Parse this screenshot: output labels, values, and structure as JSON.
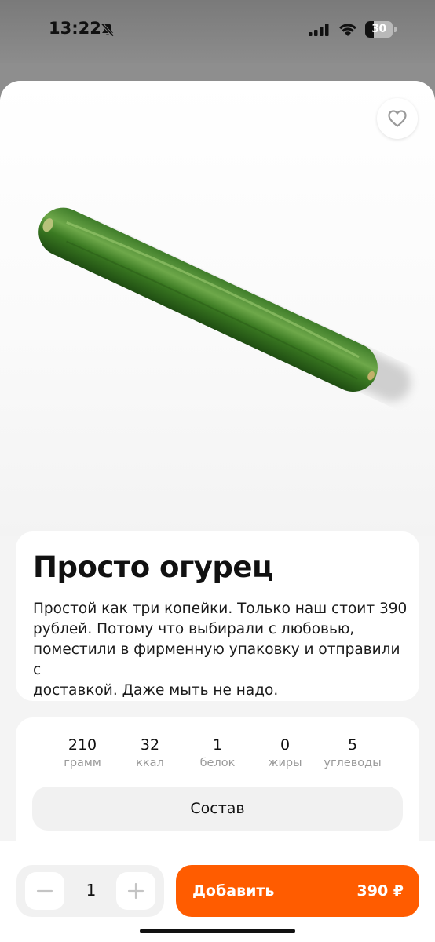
{
  "status_bar": {
    "time": "13:22",
    "battery_level": "30",
    "silent_mode_icon": "bell-slash-icon",
    "signal_icon": "cellular-signal-icon",
    "wifi_icon": "wifi-icon"
  },
  "product": {
    "image_icon": "cucumber-photo",
    "favorite_icon": "heart-icon",
    "title": "Просто огурец",
    "description_lines": [
      "Простой как три копейки. Только наш стоит 390",
      "рублей. Потому что выбирали с любовью,",
      "поместили в фирменную упаковку и отправили с",
      "доставкой. Даже мыть не надо."
    ]
  },
  "nutrition": [
    {
      "value": "210",
      "label": "грамм"
    },
    {
      "value": "32",
      "label": "ккал"
    },
    {
      "value": "1",
      "label": "белок"
    },
    {
      "value": "0",
      "label": "жиры"
    },
    {
      "value": "5",
      "label": "углеводы"
    }
  ],
  "composition_button": "Состав",
  "cart": {
    "quantity": "1",
    "minus_icon": "minus-icon",
    "plus_icon": "plus-icon",
    "add_label": "Добавить",
    "price": "390 ₽"
  },
  "colors": {
    "accent": "#ff5c00",
    "background": "#f4f4f4",
    "card": "#ffffff",
    "muted_text": "#9a9a9a"
  }
}
